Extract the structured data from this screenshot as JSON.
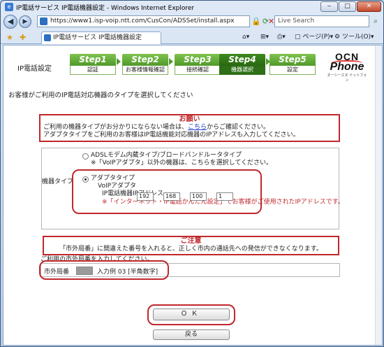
{
  "window": {
    "title": "IP電話サービス IP電話機器設定 - Windows Internet Explorer",
    "minimize": "‒",
    "maximize": "□",
    "close": "✕"
  },
  "browser": {
    "url": "https://www1.isp-voip.ntt.com/CusCon/ADSSet/install.aspx",
    "search_placeholder": "Live Search",
    "tab_title": "IP電話サービス IP電話機器設定",
    "page_menu": "ページ(P)",
    "tools_menu": "ツール(O)"
  },
  "page": {
    "heading": "IP電話設定",
    "steps": [
      {
        "step": "Step1",
        "label": "認証"
      },
      {
        "step": "Step2",
        "label": "お客様情報確認"
      },
      {
        "step": "Step3",
        "label": "接続確認"
      },
      {
        "step": "Step4",
        "label": "機器選択"
      },
      {
        "step": "Step5",
        "label": "設定"
      }
    ],
    "logo": {
      "top": "OCN",
      "bottom": "Phone",
      "sub": "オーシーエヌ ドットフォン"
    },
    "question": "お客様がご利用のIP電話対応機器のタイプを選択してください",
    "notice": {
      "title": "お願い",
      "line1_pre": "ご利用の機器タイプがお分かりにならない場合は、",
      "line1_link": "こちら",
      "line1_post": "からご確認ください。",
      "line2": "アダプタタイプをご利用のお客様はIP電話機能対応機器のIPアドレスも入力してください。"
    },
    "form": {
      "label": "機器タイプ",
      "option1_title": "ADSLモデム内蔵タイプ/ブロードバンドルータタイプ",
      "option1_note": "※「VoIPアダプタ」以外の機器は、こちらを選択してください。",
      "option2_title": "アダプタタイプ",
      "option2_sub": "VoIPアダプタ",
      "ip_label": "IP電話機器IPアドレス",
      "ip": [
        "192",
        "168",
        "100",
        "1"
      ],
      "ip_note": "※「インターネット・IP電話かんたん設定」でお客様がご使用されたIPアドレスです。"
    },
    "caution": {
      "title": "ご注意",
      "line": "「市外局番」に間違えた番号を入れると、正しく市内の通話先への発信ができなくなります。"
    },
    "area_hint": "ご利用の市外局番を入力してください。",
    "area_label": "市外局番",
    "area_example": "入力例 03 [半角数字]",
    "ok_button": "ＯＫ",
    "back_button": "戻る"
  }
}
